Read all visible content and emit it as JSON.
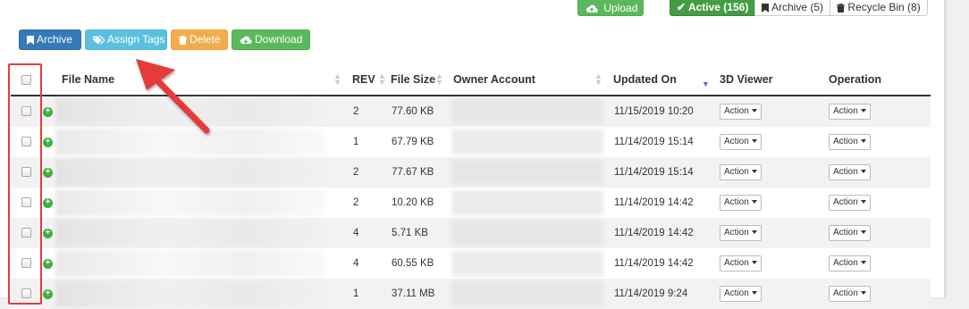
{
  "toolbar": {
    "archive_label": "Archive",
    "assign_tags_label": "Assign Tags",
    "delete_label": "Delete",
    "download_label": "Download"
  },
  "top": {
    "upload_label": "Upload",
    "active_label": "Active (156)",
    "archive_label": "Archive (5)",
    "recycle_label": "Recycle Bin (8)"
  },
  "table": {
    "headers": {
      "file_name": "File Name",
      "rev": "REV",
      "file_size": "File Size",
      "owner": "Owner Account",
      "updated": "Updated On",
      "viewer": "3D Viewer",
      "operation": "Operation"
    },
    "action_label": "Action",
    "rows": [
      {
        "rev": "2",
        "size": "77.60 KB",
        "updated": "11/15/2019 10:20"
      },
      {
        "rev": "1",
        "size": "67.79 KB",
        "updated": "11/14/2019 15:14"
      },
      {
        "rev": "2",
        "size": "77.67 KB",
        "updated": "11/14/2019 15:14"
      },
      {
        "rev": "2",
        "size": "10.20 KB",
        "updated": "11/14/2019 14:42"
      },
      {
        "rev": "4",
        "size": "5.71 KB",
        "updated": "11/14/2019 14:42"
      },
      {
        "rev": "4",
        "size": "60.55 KB",
        "updated": "11/14/2019 14:42"
      },
      {
        "rev": "1",
        "size": "37.11 MB",
        "updated": "11/14/2019 9:24"
      }
    ]
  },
  "colors": {
    "primary": "#337ab7",
    "info": "#5bc0de",
    "warning": "#f0ad4e",
    "success": "#5cb85c",
    "annotation": "#e53b3b"
  },
  "icons": {
    "archive": "bookmark-icon",
    "tags": "tags-icon",
    "delete": "trash-icon",
    "download": "cloud-download-icon",
    "upload": "cloud-upload-icon",
    "active": "check-icon",
    "recycle": "trash-icon",
    "expand": "plus-circle-icon"
  }
}
